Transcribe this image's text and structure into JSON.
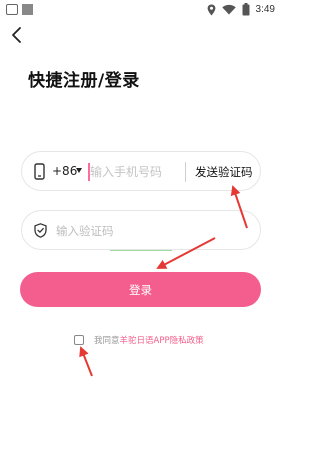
{
  "status_bar": {
    "time": "3:49",
    "icons": [
      "location-icon",
      "wifi-icon",
      "battery-icon"
    ]
  },
  "page": {
    "title": "快捷注册/登录"
  },
  "phone_field": {
    "icon": "phone-icon",
    "country_code": "+86",
    "placeholder": "输入手机号码",
    "value": "",
    "send_code_label": "发送验证码"
  },
  "code_field": {
    "icon": "shield-icon",
    "placeholder": "输入验证码",
    "value": ""
  },
  "login_button": {
    "label": "登录"
  },
  "agreement": {
    "checked": false,
    "prefix": "我同意",
    "link_text": "羊驼日语APP隐私政策"
  },
  "colors": {
    "accent": "#f35e8e",
    "annotation_arrow": "#e53935"
  }
}
